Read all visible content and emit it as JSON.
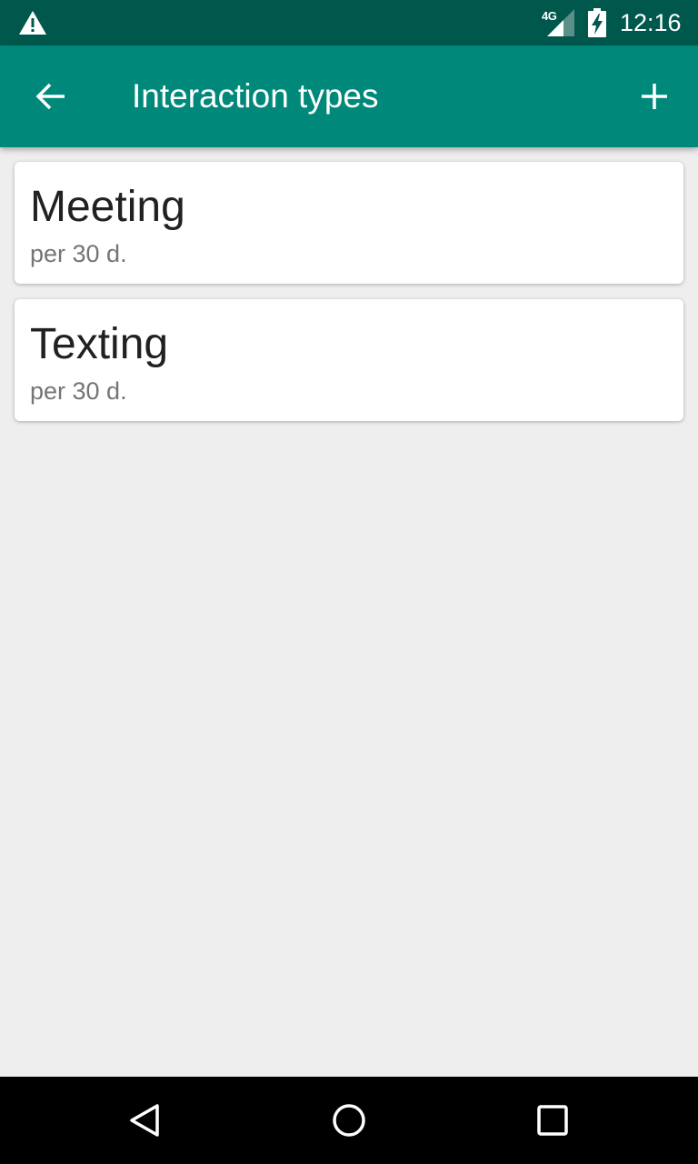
{
  "status_bar": {
    "network_label": "4G",
    "time": "12:16",
    "icons": [
      "warning-icon",
      "signal-icon",
      "battery-charging-icon"
    ]
  },
  "app_bar": {
    "title": "Interaction types",
    "back_icon": "arrow-back-icon",
    "add_icon": "add-icon",
    "color": "#00897b"
  },
  "list": {
    "items": [
      {
        "name": "Meeting",
        "period": "per 30 d."
      },
      {
        "name": "Texting",
        "period": "per 30 d."
      }
    ]
  },
  "nav_bar": {
    "icons": [
      "back-triangle-icon",
      "home-circle-icon",
      "recents-square-icon"
    ]
  },
  "colors": {
    "status_bar": "#00574b",
    "app_bar": "#00897b",
    "background": "#eeeeee",
    "card": "#ffffff"
  }
}
